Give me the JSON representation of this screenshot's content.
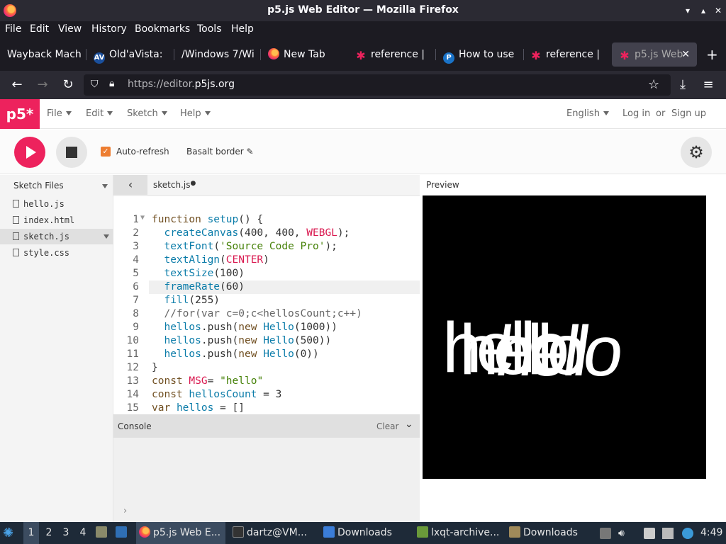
{
  "window": {
    "title": "p5.js Web Editor — Mozilla Firefox",
    "controls": [
      "▾",
      "▴",
      "✕"
    ]
  },
  "menubar": [
    "File",
    "Edit",
    "View",
    "History",
    "Bookmarks",
    "Tools",
    "Help"
  ],
  "tabs": [
    {
      "label": "Wayback Mach",
      "icon": "wayback-icon"
    },
    {
      "label": "Old'aVista:",
      "icon": "av-icon"
    },
    {
      "label": "/Windows 7/Wi",
      "icon": "folder-icon"
    },
    {
      "label": "New Tab",
      "icon": "firefox-icon"
    },
    {
      "label": "reference |",
      "icon": "p5-star-icon"
    },
    {
      "label": "How to use",
      "icon": "p-icon"
    },
    {
      "label": "reference |",
      "icon": "p5-star-icon"
    },
    {
      "label": "p5.js Web",
      "icon": "p5-star-icon",
      "active": true
    }
  ],
  "newtab": "+",
  "tab_close": "✕",
  "nav": {
    "url_dim": "https://editor.",
    "url_host": "p5js.org"
  },
  "p5": {
    "logo": "p5*",
    "menus": [
      "File",
      "Edit",
      "Sketch",
      "Help"
    ],
    "language": "English",
    "login": "Log in",
    "or": "or",
    "signup": "Sign up",
    "autorefresh": "Auto-refresh",
    "sketch_name": "Basalt border",
    "accent": "#ed225d"
  },
  "sidebar": {
    "header": "Sketch Files",
    "files": [
      "hello.js",
      "index.html",
      "sketch.js",
      "style.css"
    ],
    "selected": "sketch.js"
  },
  "editor": {
    "filename": "sketch.js",
    "lines": [
      "function setup() {",
      "  createCanvas(400, 400, WEBGL);",
      "  textFont('Source Code Pro');",
      "  textAlign(CENTER)",
      "  textSize(100)",
      "  frameRate(60)",
      "  fill(255)",
      "  //for(var c=0;c<hellosCount;c++)",
      "  hellos.push(new Hello(1000))",
      "  hellos.push(new Hello(500))",
      "  hellos.push(new Hello(0))",
      "}",
      "const MSG= \"hello\"",
      "const hellosCount = 3",
      "var hellos = []"
    ],
    "line_numbers": [
      "1",
      "2",
      "3",
      "4",
      "5",
      "6",
      "7",
      "8",
      "9",
      "10",
      "11",
      "12",
      "13",
      "14",
      "15"
    ]
  },
  "console": {
    "title": "Console",
    "clear": "Clear",
    "prompt": "›"
  },
  "preview": {
    "label": "Preview",
    "texts": [
      "hello",
      "hello",
      "hello"
    ]
  },
  "taskbar": {
    "workspaces": [
      "1",
      "2",
      "3",
      "4"
    ],
    "items": [
      "p5.js Web E...",
      "dartz@VM...",
      "Downloads",
      "lxqt-archive...",
      "Downloads"
    ],
    "clock": "4:49"
  }
}
